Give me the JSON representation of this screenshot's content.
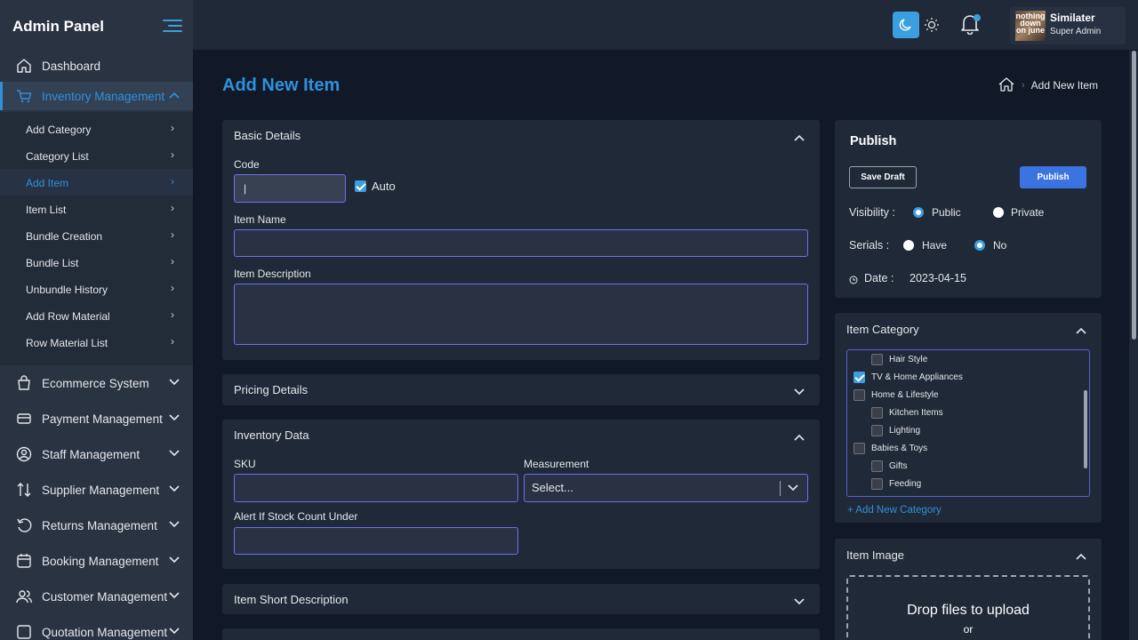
{
  "sidebar": {
    "brand": "Admin Panel",
    "top_items": [
      {
        "label": "Dashboard",
        "icon": "home-icon"
      },
      {
        "label": "Inventory Management",
        "icon": "cart-icon"
      }
    ],
    "sub_items": [
      "Add Category",
      "Category List",
      "Add Item",
      "Item List",
      "Bundle Creation",
      "Bundle List",
      "Unbundle History",
      "Add Row Material",
      "Row Material List"
    ],
    "bottom_items": [
      {
        "label": "Ecommerce System",
        "icon": "bag-icon"
      },
      {
        "label": "Payment Management",
        "icon": "card-icon"
      },
      {
        "label": "Staff Management",
        "icon": "user-circle-icon"
      },
      {
        "label": "Supplier Management",
        "icon": "arrows-updown-icon"
      },
      {
        "label": "Returns Management",
        "icon": "return-icon"
      },
      {
        "label": "Booking Management",
        "icon": "calendar-icon"
      },
      {
        "label": "Customer Management",
        "icon": "users-icon"
      },
      {
        "label": "Quotation Management",
        "icon": "quote-icon"
      }
    ]
  },
  "header": {
    "user_name": "Similater",
    "user_role": "Super Admin",
    "avatar_text": "nothing down on june",
    "theme_dark_icon": "moon-icon",
    "theme_light_icon": "sun-icon",
    "notification_icon": "bell-icon"
  },
  "page": {
    "title": "Add New Item",
    "breadcrumb_current": "Add New Item"
  },
  "basic_details": {
    "title": "Basic Details",
    "code_label": "Code",
    "code_value": "|",
    "auto_label": "Auto",
    "item_name_label": "Item Name",
    "item_name_value": "",
    "description_label": "Item Description",
    "description_value": ""
  },
  "pricing": {
    "title": "Pricing Details"
  },
  "inventory": {
    "title": "Inventory Data",
    "sku_label": "SKU",
    "sku_value": "",
    "measurement_label": "Measurement",
    "measurement_value": "Select...",
    "alert_label": "Alert If Stock Count Under",
    "alert_value": ""
  },
  "short_description": {
    "title": "Item Short Description"
  },
  "publish": {
    "title": "Publish",
    "save_draft": "Save Draft",
    "publish_btn": "Publish",
    "visibility_label": "Visibility :",
    "public_label": "Public",
    "private_label": "Private",
    "serials_label": "Serials :",
    "have_label": "Have",
    "no_label": "No",
    "date_label": "Date :",
    "date_value": "2023-04-15"
  },
  "category": {
    "title": "Item Category",
    "items": [
      {
        "label": "Hair Style",
        "checked": false,
        "indent": 1
      },
      {
        "label": "TV & Home Appliances",
        "checked": true,
        "indent": 0
      },
      {
        "label": "Home & Lifestyle",
        "checked": false,
        "indent": 0
      },
      {
        "label": "Kitchen Items",
        "checked": false,
        "indent": 1
      },
      {
        "label": "Lighting",
        "checked": false,
        "indent": 1
      },
      {
        "label": "Babies & Toys",
        "checked": false,
        "indent": 0
      },
      {
        "label": "Gifts",
        "checked": false,
        "indent": 1
      },
      {
        "label": "Feeding",
        "checked": false,
        "indent": 1
      }
    ],
    "add_link": "+ Add New Category"
  },
  "item_image": {
    "title": "Item Image",
    "drop_title": "Drop files to upload",
    "drop_or": "or"
  },
  "colors": {
    "accent": "#2f91da",
    "sidebar_bg": "#2a3342",
    "card_bg": "#1f2937",
    "page_bg": "#111827",
    "input_border": "#6f71ec",
    "primary_button": "#3b74e0"
  }
}
